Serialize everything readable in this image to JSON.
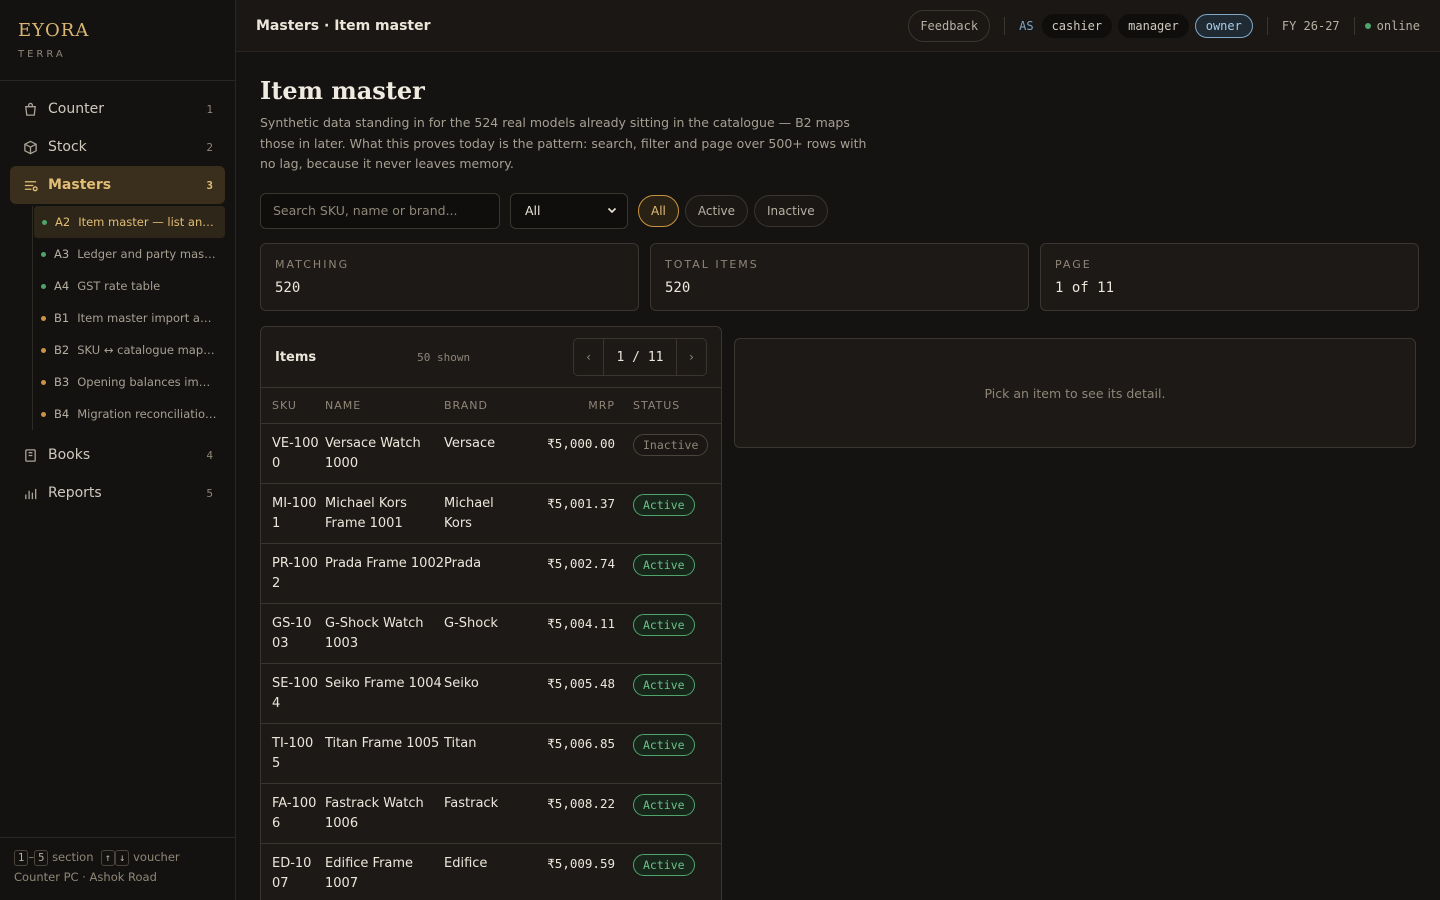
{
  "brand": {
    "name": "EYORA",
    "sub": "TERRA"
  },
  "nav": [
    {
      "label": "Counter",
      "num": "1"
    },
    {
      "label": "Stock",
      "num": "2"
    },
    {
      "label": "Masters",
      "num": "3"
    },
    {
      "label": "Books",
      "num": "4"
    },
    {
      "label": "Reports",
      "num": "5"
    }
  ],
  "subnav": [
    {
      "code": "A2",
      "label": "Item master — list and d...",
      "status": "green"
    },
    {
      "code": "A3",
      "label": "Ledger and party master",
      "status": "green"
    },
    {
      "code": "A4",
      "label": "GST rate table",
      "status": "green"
    },
    {
      "code": "B1",
      "label": "Item master import and...",
      "status": "orange"
    },
    {
      "code": "B2",
      "label": "SKU ↔ catalogue mappi...",
      "status": "orange"
    },
    {
      "code": "B3",
      "label": "Opening balances import",
      "status": "orange"
    },
    {
      "code": "B4",
      "label": "Migration reconciliation ...",
      "status": "orange"
    }
  ],
  "footer": {
    "k1": "1",
    "dash": "–",
    "k2": "5",
    "section": "section",
    "k3": "↑",
    "k4": "↓",
    "voucher": "voucher",
    "location": "Counter PC · Ashok Road"
  },
  "topbar": {
    "crumb": "Masters · Item master",
    "feedback": "Feedback",
    "as": "AS",
    "roles": [
      "cashier",
      "manager",
      "owner"
    ],
    "selected_role": "owner",
    "fy": "FY 26-27",
    "status": "online"
  },
  "page": {
    "title": "Item master",
    "description": "Synthetic data standing in for the 524 real models already sitting in the catalogue — B2 maps those in later. What this proves today is the pattern: search, filter and page over 500+ rows with no lag, because it never leaves memory.",
    "search_placeholder": "Search SKU, name or brand...",
    "select_value": "All",
    "chips": [
      "All",
      "Active",
      "Inactive"
    ]
  },
  "stats": [
    {
      "label": "MATCHING",
      "value": "520"
    },
    {
      "label": "TOTAL ITEMS",
      "value": "520"
    },
    {
      "label": "PAGE",
      "value": "1 of 11"
    }
  ],
  "items": {
    "title": "Items",
    "shown": "50 shown",
    "page": "1 / 11",
    "prev": "‹",
    "next": "›",
    "columns": [
      "SKU",
      "NAME",
      "BRAND",
      "MRP",
      "STATUS"
    ],
    "rows": [
      {
        "sku": "VE-1000",
        "name": "Versace Watch 1000",
        "brand": "Versace",
        "mrp": "₹5,000.00",
        "status": "Inactive"
      },
      {
        "sku": "MI-1001",
        "name": "Michael Kors Frame 1001",
        "brand": "Michael Kors",
        "mrp": "₹5,001.37",
        "status": "Active"
      },
      {
        "sku": "PR-1002",
        "name": "Prada Frame 1002",
        "brand": "Prada",
        "mrp": "₹5,002.74",
        "status": "Active"
      },
      {
        "sku": "GS-1003",
        "name": "G-Shock Watch 1003",
        "brand": "G-Shock",
        "mrp": "₹5,004.11",
        "status": "Active"
      },
      {
        "sku": "SE-1004",
        "name": "Seiko Frame 1004",
        "brand": "Seiko",
        "mrp": "₹5,005.48",
        "status": "Active"
      },
      {
        "sku": "TI-1005",
        "name": "Titan Frame 1005",
        "brand": "Titan",
        "mrp": "₹5,006.85",
        "status": "Active"
      },
      {
        "sku": "FA-1006",
        "name": "Fastrack Watch 1006",
        "brand": "Fastrack",
        "mrp": "₹5,008.22",
        "status": "Active"
      },
      {
        "sku": "ED-1007",
        "name": "Edifice Frame 1007",
        "brand": "Edifice",
        "mrp": "₹5,009.59",
        "status": "Active"
      }
    ]
  },
  "detail": {
    "empty": "Pick an item to see its detail."
  }
}
